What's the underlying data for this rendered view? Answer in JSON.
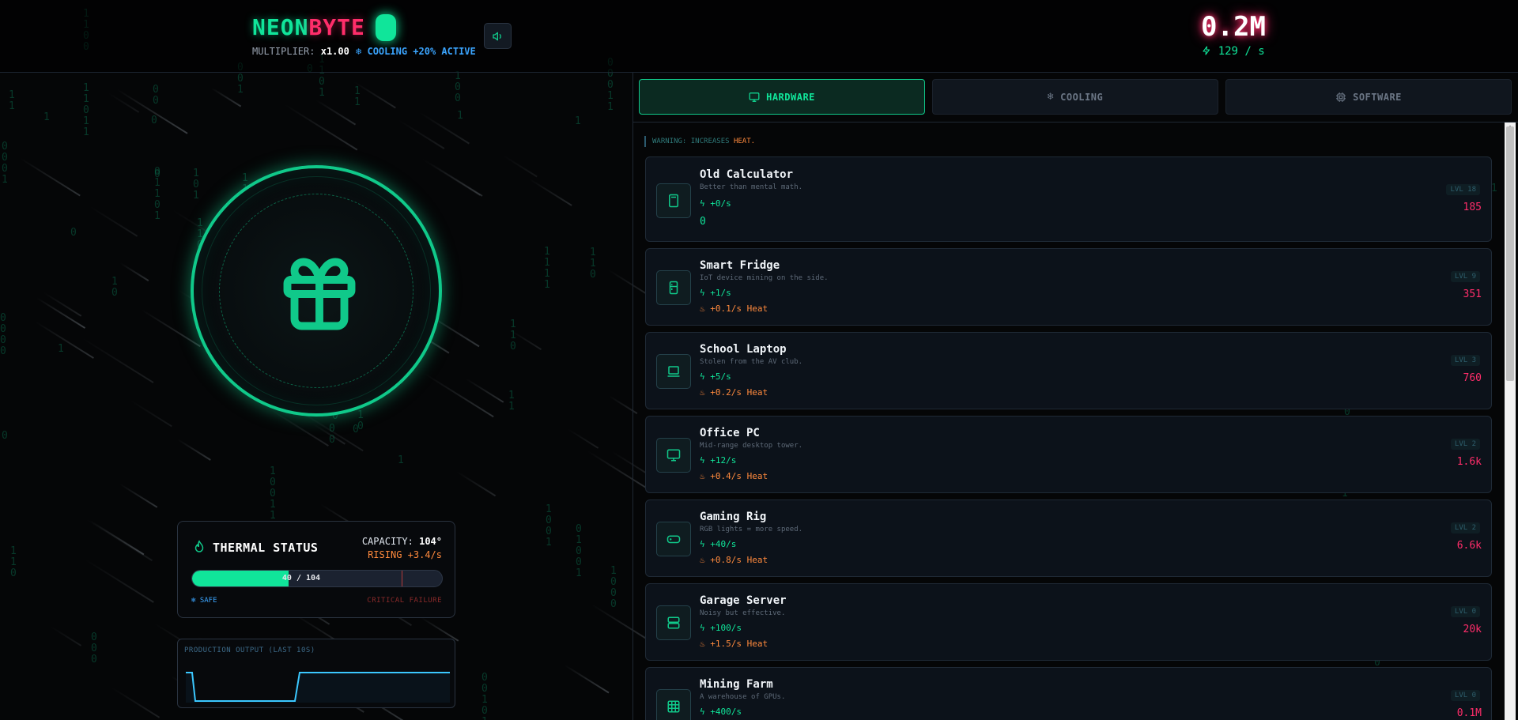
{
  "header": {
    "logo_part1": "NEON",
    "logo_part2": "BYTE",
    "multiplier_label": "MULTIPLIER:",
    "multiplier_value": "x1.00",
    "cooling_status": "COOLING +20% ACTIVE",
    "total": "0.2M",
    "rate": "129 / s"
  },
  "tabs": [
    {
      "label": "HARDWARE",
      "icon": "monitor-icon",
      "active": true
    },
    {
      "label": "COOLING",
      "icon": "snowflake-icon",
      "active": false
    },
    {
      "label": "SOFTWARE",
      "icon": "cpu-icon",
      "active": false
    }
  ],
  "warning": {
    "prefix": "WARNING: INCREASES",
    "heat": "HEAT."
  },
  "items": [
    {
      "name": "Old Calculator",
      "desc": "Better than mental math.",
      "prod": "+0/s",
      "heat": "",
      "owned": "0",
      "level": "LVL 18",
      "cost": "185",
      "icon": "calculator-icon"
    },
    {
      "name": "Smart Fridge",
      "desc": "IoT device mining on the side.",
      "prod": "+1/s",
      "heat": "+0.1/s Heat",
      "owned": "",
      "level": "LVL 9",
      "cost": "351",
      "icon": "fridge-icon"
    },
    {
      "name": "School Laptop",
      "desc": "Stolen from the AV club.",
      "prod": "+5/s",
      "heat": "+0.2/s Heat",
      "owned": "",
      "level": "LVL 3",
      "cost": "760",
      "icon": "laptop-icon"
    },
    {
      "name": "Office PC",
      "desc": "Mid-range desktop tower.",
      "prod": "+12/s",
      "heat": "+0.4/s Heat",
      "owned": "",
      "level": "LVL 2",
      "cost": "1.6k",
      "icon": "monitor-icon"
    },
    {
      "name": "Gaming Rig",
      "desc": "RGB lights = more speed.",
      "prod": "+40/s",
      "heat": "+0.8/s Heat",
      "owned": "",
      "level": "LVL 2",
      "cost": "6.6k",
      "icon": "gamepad-icon"
    },
    {
      "name": "Garage Server",
      "desc": "Noisy but effective.",
      "prod": "+100/s",
      "heat": "+1.5/s Heat",
      "owned": "",
      "level": "LVL 0",
      "cost": "20k",
      "icon": "server-icon"
    },
    {
      "name": "Mining Farm",
      "desc": "A warehouse of GPUs.",
      "prod": "+400/s",
      "heat": "",
      "owned": "",
      "level": "LVL 0",
      "cost": "0.1M",
      "icon": "grid-icon"
    }
  ],
  "thermal": {
    "title": "THERMAL STATUS",
    "capacity_label": "CAPACITY:",
    "capacity_value": "104°",
    "rising": "RISING +3.4/s",
    "bar_text": "40 / 104",
    "bar_fraction": 0.385,
    "critical_fraction": 0.84,
    "safe_label": "SAFE",
    "critical_label": "CRITICAL FAILURE"
  },
  "production": {
    "title": "PRODUCTION OUTPUT (LAST 10S)"
  },
  "colors": {
    "accent": "#10e59a",
    "brand_pink": "#ff2d6a",
    "heat": "#ff8a3d",
    "cool": "#3ba5ff"
  }
}
